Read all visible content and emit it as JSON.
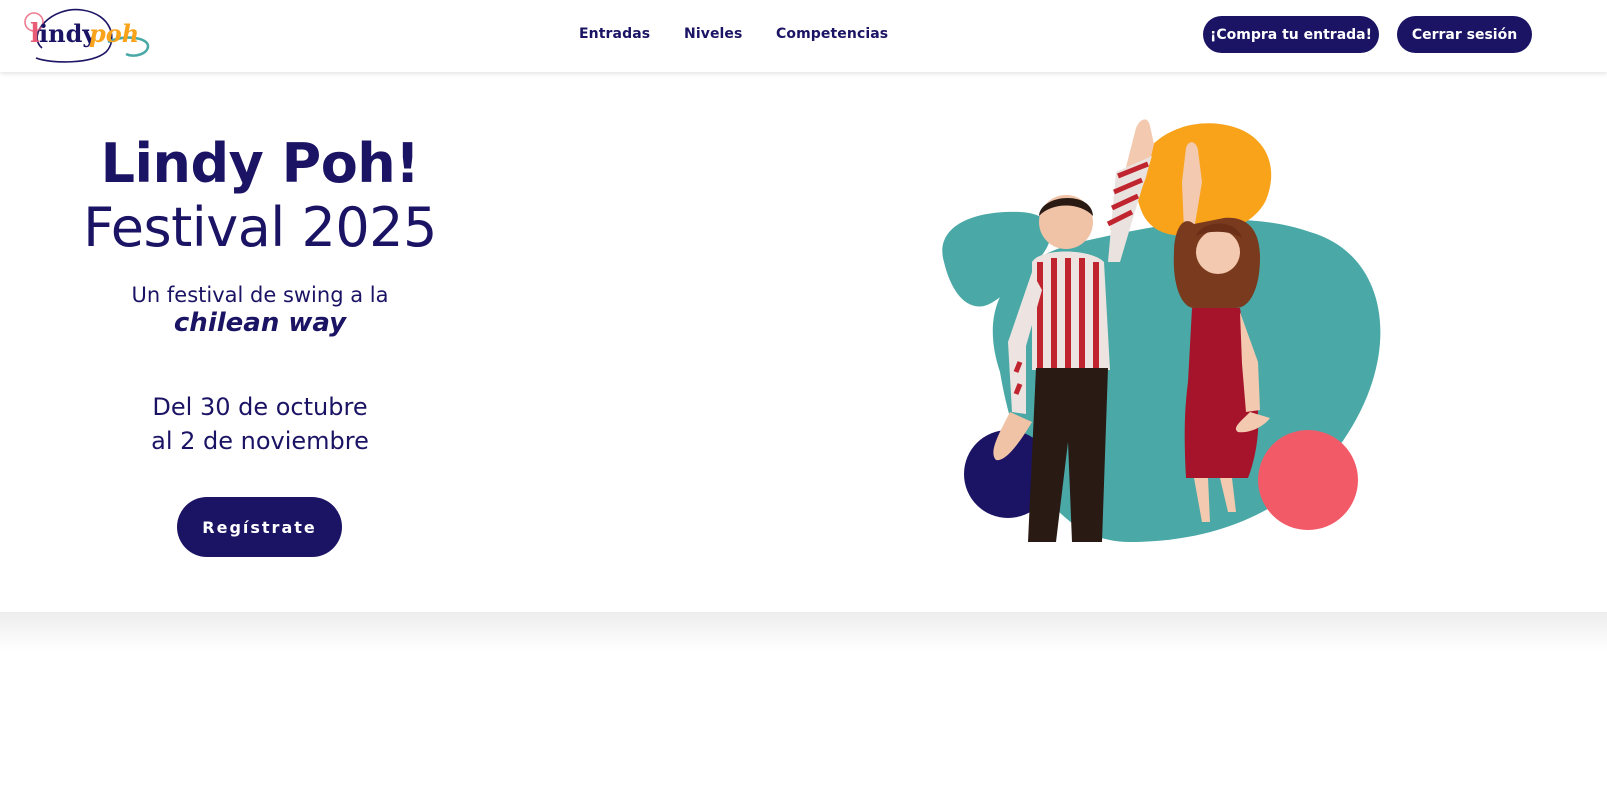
{
  "header": {
    "logo_text": "lindypoh",
    "nav": [
      {
        "label": "Entradas"
      },
      {
        "label": "Niveles"
      },
      {
        "label": "Competencias"
      }
    ],
    "buy_button": "¡Compra tu entrada!",
    "logout_button": "Cerrar sesión"
  },
  "hero": {
    "title_line1": "Lindy Poh!",
    "title_line2": "Festival 2025",
    "tagline": "Un festival de swing a la",
    "tagline_emphasis": "chilean way",
    "dates_line1": "Del 30 de octubre",
    "dates_line2": "al 2 de noviembre",
    "cta_label": "Regístrate"
  },
  "colors": {
    "navy": "#1b1464",
    "teal": "#4aa9a6",
    "orange": "#f9a31b",
    "coral": "#f25a68",
    "pink": "#e85d75"
  },
  "icons": {
    "logo": "lindy-poh-logo",
    "hero_art": "dancing-couple-illustration"
  }
}
